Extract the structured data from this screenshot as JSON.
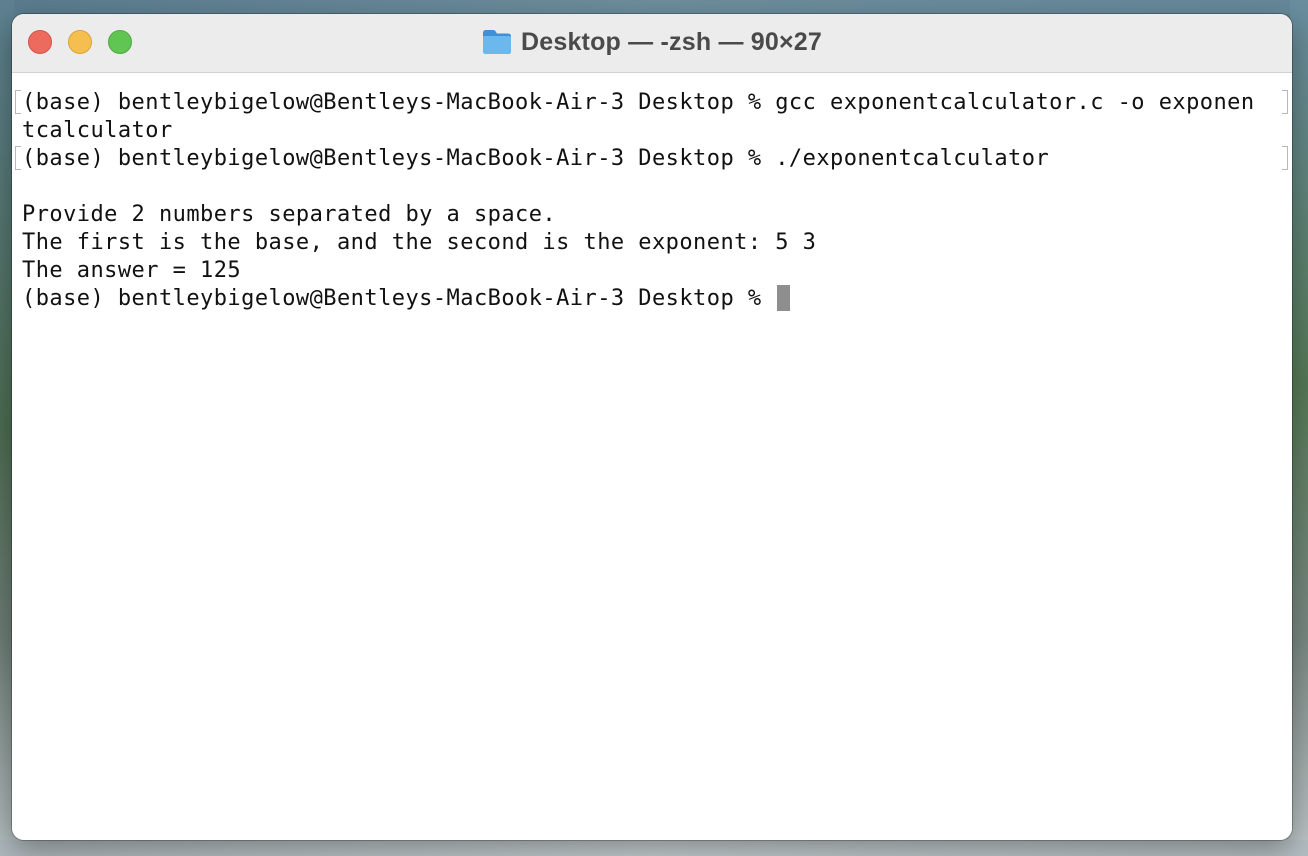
{
  "window": {
    "title": "Desktop — -zsh — 90×27",
    "title_icon": "folder-icon"
  },
  "terminal": {
    "lines": [
      "(base) bentleybigelow@Bentleys-MacBook-Air-3 Desktop % gcc exponentcalculator.c -o exponen",
      "tcalculator",
      "(base) bentleybigelow@Bentleys-MacBook-Air-3 Desktop % ./exponentcalculator",
      "",
      "Provide 2 numbers separated by a space.",
      "The first is the base, and the second is the exponent: 5 3",
      "The answer = 125",
      "(base) bentleybigelow@Bentleys-MacBook-Air-3 Desktop % "
    ]
  },
  "colors": {
    "close": "#ec6a5e",
    "minimize": "#f4bf4f",
    "maximize": "#61c554",
    "folder": "#5aa9e6"
  }
}
